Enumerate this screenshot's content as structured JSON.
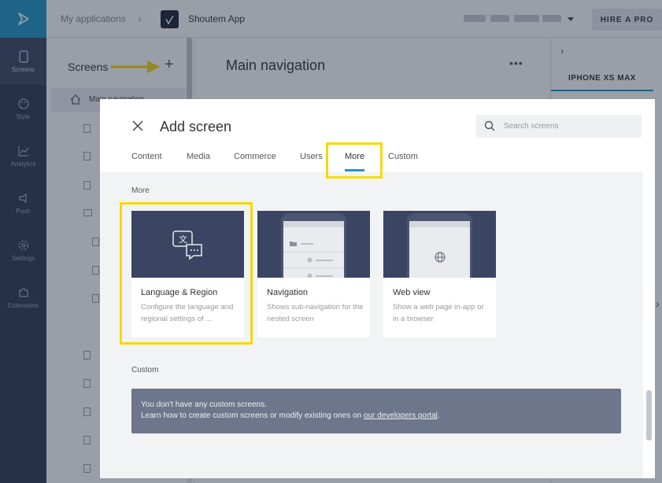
{
  "topbar": {
    "breadcrumb": "My applications",
    "separator": "›",
    "app_name": "Shoutem App",
    "hire_button": "HIRE A PRO"
  },
  "leftnav": {
    "items": [
      {
        "label": "Screens",
        "icon": "screens-icon"
      },
      {
        "label": "Style",
        "icon": "palette-icon"
      },
      {
        "label": "Analytics",
        "icon": "chart-icon"
      },
      {
        "label": "Push",
        "icon": "push-icon"
      },
      {
        "label": "Settings",
        "icon": "gear-icon"
      },
      {
        "label": "Extensions",
        "icon": "puzzle-icon"
      }
    ]
  },
  "screens_panel": {
    "title": "Screens",
    "add": "+",
    "main_item": "Main navigation"
  },
  "main": {
    "title": "Main navigation",
    "more": "•••"
  },
  "preview": {
    "chevron": "›",
    "device": "IPHONE XS MAX",
    "next": "›"
  },
  "modal": {
    "title": "Add screen",
    "search_placeholder": "Search screens",
    "tabs": [
      "Content",
      "Media",
      "Commerce",
      "Users",
      "More",
      "Custom"
    ],
    "active_tab": "More",
    "more_section": "More",
    "cards": [
      {
        "title": "Language & Region",
        "desc": "Configure the language and regional settings of ..."
      },
      {
        "title": "Navigation",
        "desc": "Shows sub-navigation for the nested screen"
      },
      {
        "title": "Web view",
        "desc": "Show a web page in-app or in a browser"
      }
    ],
    "custom_section": "Custom",
    "custom_info_line1": "You don't have any custom screens.",
    "custom_info_line2": "Learn how to create custom screens or modify existing ones on ",
    "custom_info_link": "our developers portal",
    "custom_info_end": "."
  },
  "colors": {
    "accent": "#1e95c8",
    "nav_bg": "#2d3a55",
    "highlight": "#f5d90a"
  }
}
